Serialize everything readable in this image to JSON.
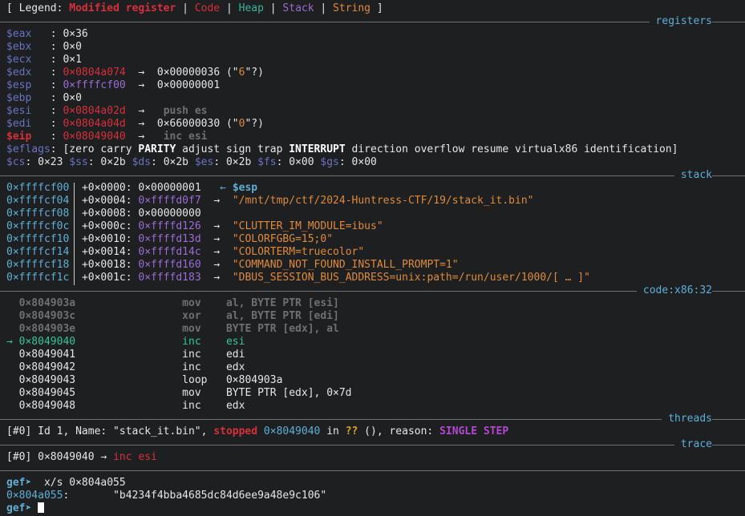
{
  "legend": {
    "open": "[ Legend: ",
    "modified": "Modified register",
    "sep": " | ",
    "code": "Code",
    "heap": "Heap",
    "stack": "Stack",
    "string": "String",
    "close": " ]"
  },
  "sections": {
    "registers": "registers",
    "stack": "stack",
    "code": "code:x86:32",
    "threads": "threads",
    "trace": "trace"
  },
  "registers": [
    {
      "name": "$eax",
      "value": "0×36",
      "modified": false
    },
    {
      "name": "$ebx",
      "value": "0×0",
      "modified": false
    },
    {
      "name": "$ecx",
      "value": "0×1",
      "modified": false
    },
    {
      "name": "$edx",
      "value": "0×0804a074",
      "arrow": "→",
      "deref": "0×00000036 (\"",
      "deref_str": "6",
      "deref_tail": "\"?)",
      "modified": false
    },
    {
      "name": "$esp",
      "value": "0×ffffcf00",
      "arrow": "→",
      "deref": "0×00000001",
      "modified": false
    },
    {
      "name": "$ebp",
      "value": "0×0",
      "modified": false
    },
    {
      "name": "$esi",
      "value": "0×0804a02d",
      "arrow": "→",
      "deref": "push es",
      "modified": false
    },
    {
      "name": "$edi",
      "value": "0×0804a04d",
      "arrow": "→",
      "deref": "0×66000030 (\"",
      "deref_str": "0",
      "deref_tail": "\"?)",
      "modified": false
    },
    {
      "name": "$eip",
      "value": "0×08049040",
      "arrow": "→",
      "deref": "inc esi",
      "modified": true
    }
  ],
  "eflags": {
    "label": "$eflags",
    "parts": [
      "[zero carry ",
      "PARITY",
      " adjust sign trap ",
      "INTERRUPT",
      " direction overflow resume virtualx86 identification]"
    ]
  },
  "segments": [
    {
      "name": "$cs",
      "value": "0×23"
    },
    {
      "name": "$ss",
      "value": "0×2b"
    },
    {
      "name": "$ds",
      "value": "0×2b"
    },
    {
      "name": "$es",
      "value": "0×2b"
    },
    {
      "name": "$fs",
      "value": "0×00"
    },
    {
      "name": "$gs",
      "value": "0×00"
    }
  ],
  "stack": [
    {
      "addr": "0×ffffcf00",
      "off": "+0×0000:",
      "val": "0×00000001",
      "arrow": "←",
      "note": "$esp",
      "note_type": "reg"
    },
    {
      "addr": "0×ffffcf04",
      "off": "+0×0004:",
      "val": "0×ffffd0f7",
      "arrow": "→",
      "note": "\"/mnt/tmp/ctf/2024-Huntress-CTF/19/stack_it.bin\"",
      "note_type": "str"
    },
    {
      "addr": "0×ffffcf08",
      "off": "+0×0008:",
      "val": "0×00000000",
      "arrow": "",
      "note": "",
      "note_type": ""
    },
    {
      "addr": "0×ffffcf0c",
      "off": "+0×000c:",
      "val": "0×ffffd126",
      "arrow": "→",
      "note": "\"CLUTTER_IM_MODULE=ibus\"",
      "note_type": "str"
    },
    {
      "addr": "0×ffffcf10",
      "off": "+0×0010:",
      "val": "0×ffffd13d",
      "arrow": "→",
      "note": "\"COLORFGBG=15;0\"",
      "note_type": "str"
    },
    {
      "addr": "0×ffffcf14",
      "off": "+0×0014:",
      "val": "0×ffffd14c",
      "arrow": "→",
      "note": "\"COLORTERM=truecolor\"",
      "note_type": "str"
    },
    {
      "addr": "0×ffffcf18",
      "off": "+0×0018:",
      "val": "0×ffffd160",
      "arrow": "→",
      "note": "\"COMMAND_NOT_FOUND_INSTALL_PROMPT=1\"",
      "note_type": "str"
    },
    {
      "addr": "0×ffffcf1c",
      "off": "+0×001c:",
      "val": "0×ffffd183",
      "arrow": "→",
      "note": "\"DBUS_SESSION_BUS_ADDRESS=unix:path=/run/user/1000/[ … ]\"",
      "note_type": "str"
    }
  ],
  "code": [
    {
      "marker": "",
      "addr": "0×804903a",
      "mnem": "mov",
      "ops": "al, BYTE PTR [esi]",
      "state": "past"
    },
    {
      "marker": "",
      "addr": "0×804903c",
      "mnem": "xor",
      "ops": "al, BYTE PTR [edi]",
      "state": "past"
    },
    {
      "marker": "",
      "addr": "0×804903e",
      "mnem": "mov",
      "ops": "BYTE PTR [edx], al",
      "state": "past"
    },
    {
      "marker": "→",
      "addr": "0×8049040",
      "mnem": "inc",
      "ops": "esi",
      "state": "current"
    },
    {
      "marker": "",
      "addr": "0×8049041",
      "mnem": "inc",
      "ops": "edi",
      "state": "next"
    },
    {
      "marker": "",
      "addr": "0×8049042",
      "mnem": "inc",
      "ops": "edx",
      "state": "next"
    },
    {
      "marker": "",
      "addr": "0×8049043",
      "mnem": "loop",
      "ops": "0×804903a",
      "state": "next"
    },
    {
      "marker": "",
      "addr": "0×8049045",
      "mnem": "mov",
      "ops": "BYTE PTR [edx], 0×7d",
      "state": "next"
    },
    {
      "marker": "",
      "addr": "0×8049048",
      "mnem": "inc",
      "ops": "edx",
      "state": "next"
    }
  ],
  "thread": {
    "id": "[#0]",
    "text1": " Id 1, Name: \"stack_it.bin\", ",
    "status": "stopped",
    "addr": "0×8049040",
    "in": " in ",
    "func": "??",
    "text2": " (), reason: ",
    "reason": "SINGLE STEP"
  },
  "trace": {
    "id": "[#0]",
    "addr": " 0×8049040 → ",
    "instr": "inc esi"
  },
  "console": {
    "prompt": "gef➤",
    "command": "  x/s 0×804a055",
    "result_addr": "0×804a055",
    "result_colon": ":",
    "result_value": "       \"b4234f4bba4685dc84d6ee9a48e9c106\"",
    "prompt2": "gef➤ "
  }
}
